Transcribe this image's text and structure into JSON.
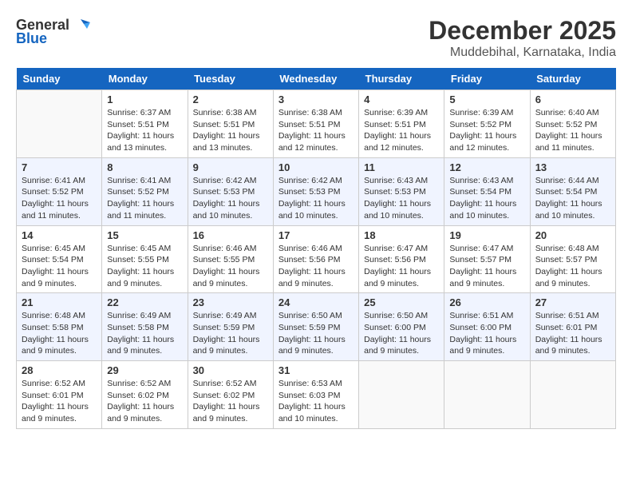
{
  "header": {
    "logo_general": "General",
    "logo_blue": "Blue",
    "month_title": "December 2025",
    "location": "Muddebihal, Karnataka, India"
  },
  "days_of_week": [
    "Sunday",
    "Monday",
    "Tuesday",
    "Wednesday",
    "Thursday",
    "Friday",
    "Saturday"
  ],
  "weeks": [
    [
      {
        "day": "",
        "sunrise": "",
        "sunset": "",
        "daylight": ""
      },
      {
        "day": "1",
        "sunrise": "Sunrise: 6:37 AM",
        "sunset": "Sunset: 5:51 PM",
        "daylight": "Daylight: 11 hours and 13 minutes."
      },
      {
        "day": "2",
        "sunrise": "Sunrise: 6:38 AM",
        "sunset": "Sunset: 5:51 PM",
        "daylight": "Daylight: 11 hours and 13 minutes."
      },
      {
        "day": "3",
        "sunrise": "Sunrise: 6:38 AM",
        "sunset": "Sunset: 5:51 PM",
        "daylight": "Daylight: 11 hours and 12 minutes."
      },
      {
        "day": "4",
        "sunrise": "Sunrise: 6:39 AM",
        "sunset": "Sunset: 5:51 PM",
        "daylight": "Daylight: 11 hours and 12 minutes."
      },
      {
        "day": "5",
        "sunrise": "Sunrise: 6:39 AM",
        "sunset": "Sunset: 5:52 PM",
        "daylight": "Daylight: 11 hours and 12 minutes."
      },
      {
        "day": "6",
        "sunrise": "Sunrise: 6:40 AM",
        "sunset": "Sunset: 5:52 PM",
        "daylight": "Daylight: 11 hours and 11 minutes."
      }
    ],
    [
      {
        "day": "7",
        "sunrise": "Sunrise: 6:41 AM",
        "sunset": "Sunset: 5:52 PM",
        "daylight": "Daylight: 11 hours and 11 minutes."
      },
      {
        "day": "8",
        "sunrise": "Sunrise: 6:41 AM",
        "sunset": "Sunset: 5:52 PM",
        "daylight": "Daylight: 11 hours and 11 minutes."
      },
      {
        "day": "9",
        "sunrise": "Sunrise: 6:42 AM",
        "sunset": "Sunset: 5:53 PM",
        "daylight": "Daylight: 11 hours and 10 minutes."
      },
      {
        "day": "10",
        "sunrise": "Sunrise: 6:42 AM",
        "sunset": "Sunset: 5:53 PM",
        "daylight": "Daylight: 11 hours and 10 minutes."
      },
      {
        "day": "11",
        "sunrise": "Sunrise: 6:43 AM",
        "sunset": "Sunset: 5:53 PM",
        "daylight": "Daylight: 11 hours and 10 minutes."
      },
      {
        "day": "12",
        "sunrise": "Sunrise: 6:43 AM",
        "sunset": "Sunset: 5:54 PM",
        "daylight": "Daylight: 11 hours and 10 minutes."
      },
      {
        "day": "13",
        "sunrise": "Sunrise: 6:44 AM",
        "sunset": "Sunset: 5:54 PM",
        "daylight": "Daylight: 11 hours and 10 minutes."
      }
    ],
    [
      {
        "day": "14",
        "sunrise": "Sunrise: 6:45 AM",
        "sunset": "Sunset: 5:54 PM",
        "daylight": "Daylight: 11 hours and 9 minutes."
      },
      {
        "day": "15",
        "sunrise": "Sunrise: 6:45 AM",
        "sunset": "Sunset: 5:55 PM",
        "daylight": "Daylight: 11 hours and 9 minutes."
      },
      {
        "day": "16",
        "sunrise": "Sunrise: 6:46 AM",
        "sunset": "Sunset: 5:55 PM",
        "daylight": "Daylight: 11 hours and 9 minutes."
      },
      {
        "day": "17",
        "sunrise": "Sunrise: 6:46 AM",
        "sunset": "Sunset: 5:56 PM",
        "daylight": "Daylight: 11 hours and 9 minutes."
      },
      {
        "day": "18",
        "sunrise": "Sunrise: 6:47 AM",
        "sunset": "Sunset: 5:56 PM",
        "daylight": "Daylight: 11 hours and 9 minutes."
      },
      {
        "day": "19",
        "sunrise": "Sunrise: 6:47 AM",
        "sunset": "Sunset: 5:57 PM",
        "daylight": "Daylight: 11 hours and 9 minutes."
      },
      {
        "day": "20",
        "sunrise": "Sunrise: 6:48 AM",
        "sunset": "Sunset: 5:57 PM",
        "daylight": "Daylight: 11 hours and 9 minutes."
      }
    ],
    [
      {
        "day": "21",
        "sunrise": "Sunrise: 6:48 AM",
        "sunset": "Sunset: 5:58 PM",
        "daylight": "Daylight: 11 hours and 9 minutes."
      },
      {
        "day": "22",
        "sunrise": "Sunrise: 6:49 AM",
        "sunset": "Sunset: 5:58 PM",
        "daylight": "Daylight: 11 hours and 9 minutes."
      },
      {
        "day": "23",
        "sunrise": "Sunrise: 6:49 AM",
        "sunset": "Sunset: 5:59 PM",
        "daylight": "Daylight: 11 hours and 9 minutes."
      },
      {
        "day": "24",
        "sunrise": "Sunrise: 6:50 AM",
        "sunset": "Sunset: 5:59 PM",
        "daylight": "Daylight: 11 hours and 9 minutes."
      },
      {
        "day": "25",
        "sunrise": "Sunrise: 6:50 AM",
        "sunset": "Sunset: 6:00 PM",
        "daylight": "Daylight: 11 hours and 9 minutes."
      },
      {
        "day": "26",
        "sunrise": "Sunrise: 6:51 AM",
        "sunset": "Sunset: 6:00 PM",
        "daylight": "Daylight: 11 hours and 9 minutes."
      },
      {
        "day": "27",
        "sunrise": "Sunrise: 6:51 AM",
        "sunset": "Sunset: 6:01 PM",
        "daylight": "Daylight: 11 hours and 9 minutes."
      }
    ],
    [
      {
        "day": "28",
        "sunrise": "Sunrise: 6:52 AM",
        "sunset": "Sunset: 6:01 PM",
        "daylight": "Daylight: 11 hours and 9 minutes."
      },
      {
        "day": "29",
        "sunrise": "Sunrise: 6:52 AM",
        "sunset": "Sunset: 6:02 PM",
        "daylight": "Daylight: 11 hours and 9 minutes."
      },
      {
        "day": "30",
        "sunrise": "Sunrise: 6:52 AM",
        "sunset": "Sunset: 6:02 PM",
        "daylight": "Daylight: 11 hours and 9 minutes."
      },
      {
        "day": "31",
        "sunrise": "Sunrise: 6:53 AM",
        "sunset": "Sunset: 6:03 PM",
        "daylight": "Daylight: 11 hours and 10 minutes."
      },
      {
        "day": "",
        "sunrise": "",
        "sunset": "",
        "daylight": ""
      },
      {
        "day": "",
        "sunrise": "",
        "sunset": "",
        "daylight": ""
      },
      {
        "day": "",
        "sunrise": "",
        "sunset": "",
        "daylight": ""
      }
    ]
  ]
}
